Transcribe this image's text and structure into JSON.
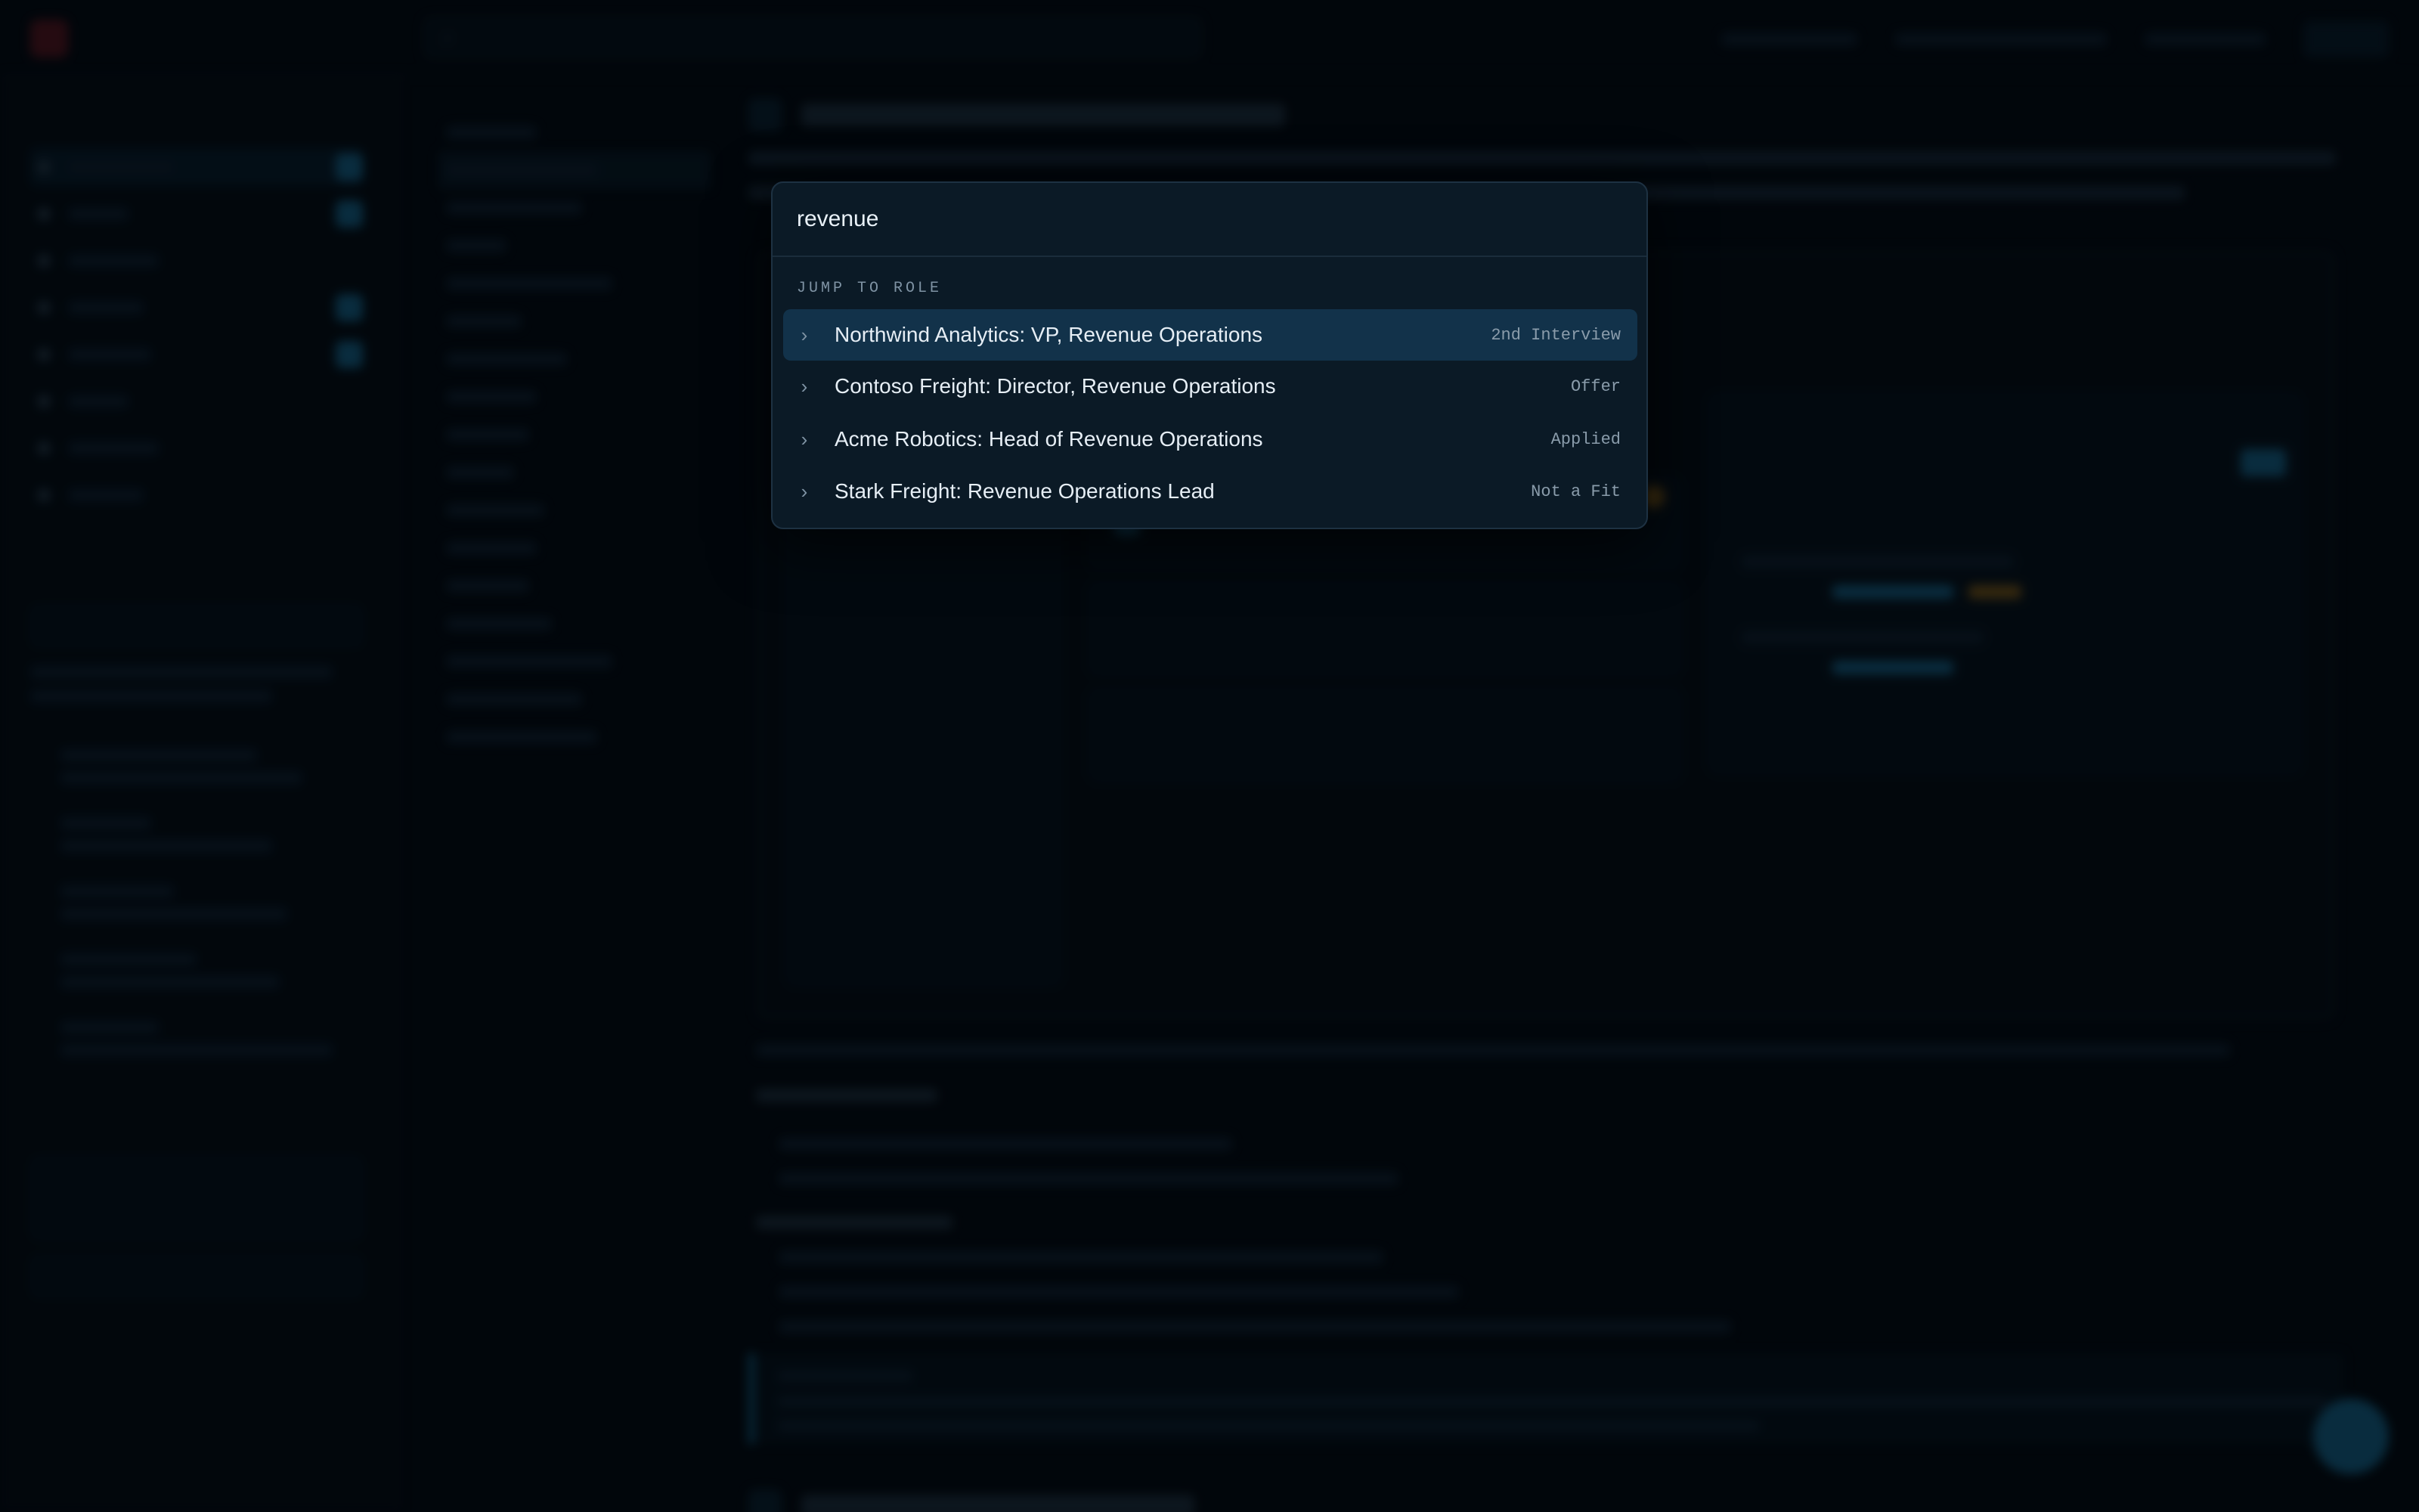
{
  "search": {
    "query": "revenue"
  },
  "palette": {
    "section_label": "JUMP TO ROLE",
    "results": [
      {
        "title": "Northwind Analytics: VP, Revenue Operations",
        "stage": "2nd Interview",
        "active": true
      },
      {
        "title": "Contoso Freight: Director, Revenue Operations",
        "stage": "Offer",
        "active": false
      },
      {
        "title": "Acme Robotics: Head of Revenue Operations",
        "stage": "Applied",
        "active": false
      },
      {
        "title": "Stark Freight: Revenue Operations Lead",
        "stage": "Not a Fit",
        "active": false
      }
    ]
  },
  "icons": {
    "result_chevron": "chevron-right-icon"
  },
  "colors": {
    "accent": "#1e87b8",
    "palette_bg": "#0b1a26",
    "active_row": "#12324a"
  }
}
